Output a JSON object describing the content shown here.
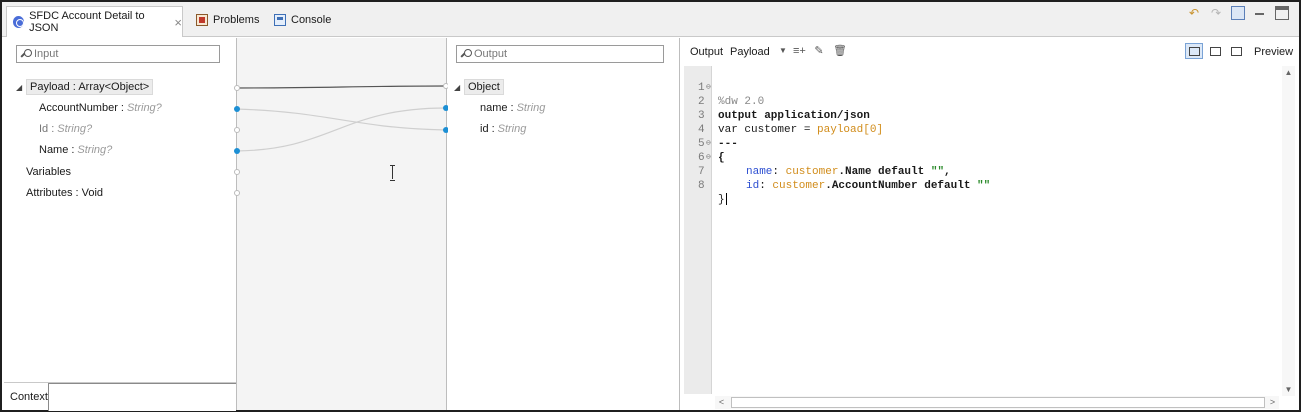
{
  "tabs": {
    "active": "SFDC Account Detail to JSON",
    "problems": "Problems",
    "console": "Console"
  },
  "input_panel": {
    "search_placeholder": "Input",
    "payload": "Payload : Array<Object>",
    "fields": [
      {
        "name": "AccountNumber",
        "type": "String?"
      },
      {
        "name": "Id",
        "type": "String?"
      },
      {
        "name": "Name",
        "type": "String?"
      }
    ],
    "variables": "Variables",
    "attributes": "Attributes : Void",
    "context_label": "Context"
  },
  "output_panel": {
    "search_placeholder": "Output",
    "root": "Object",
    "fields": [
      {
        "name": "name",
        "type": "String"
      },
      {
        "name": "id",
        "type": "String"
      }
    ]
  },
  "editor_toolbar": {
    "output_label": "Output",
    "target": "Payload",
    "preview": "Preview"
  },
  "code": {
    "line_numbers": [
      "1",
      "2",
      "3",
      "4",
      "5",
      "6",
      "7",
      "8"
    ],
    "l1_dir": "%dw 2.0",
    "l2_kw": "output application/json",
    "l3_a": "var customer = ",
    "l3_b": "payload[0]",
    "l4": "---",
    "l5": "{",
    "l6_key": "name",
    "l6_var": "customer",
    "l6_rest": ".Name default ",
    "l6_str": "\"\"",
    "l6_end": ",",
    "l7_key": "id",
    "l7_var": "customer",
    "l7_rest": ".AccountNumber default ",
    "l7_str": "\"\"",
    "l8": "}"
  }
}
